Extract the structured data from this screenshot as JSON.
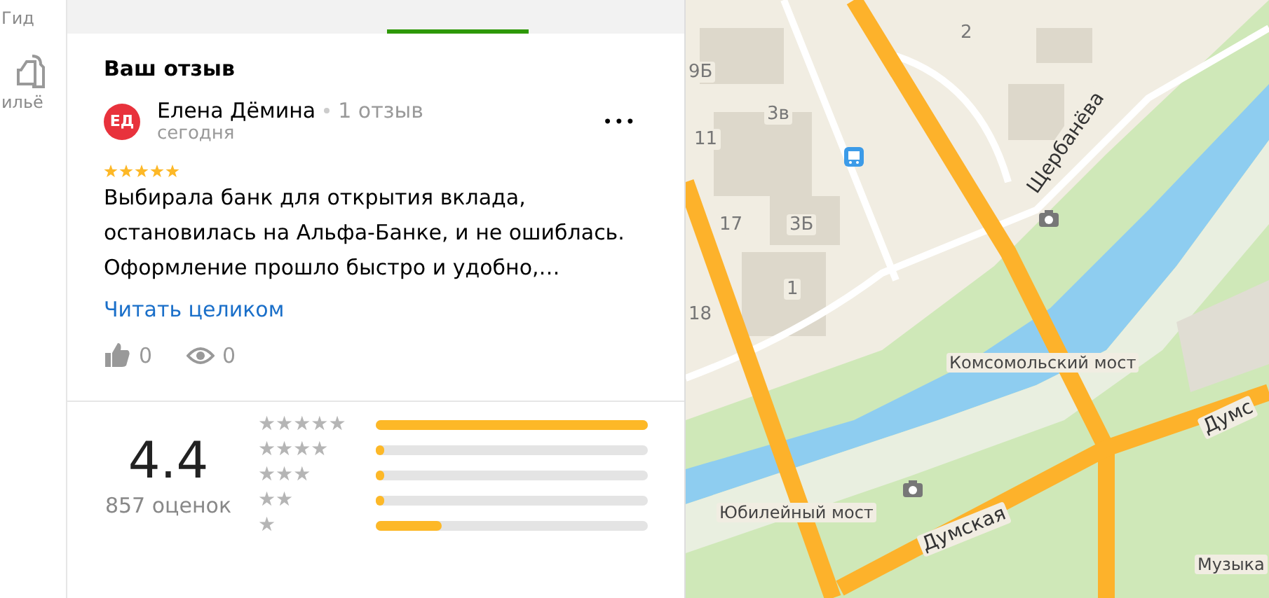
{
  "sidebar": {
    "items": [
      {
        "label": "Гид",
        "kind": "guide"
      },
      {
        "label": "ильё",
        "kind": "housing"
      }
    ]
  },
  "tabs": [
    {
      "selected": false
    },
    {
      "selected": false
    },
    {
      "selected": true
    },
    {
      "selected": false
    }
  ],
  "your_review": {
    "heading": "Ваш отзыв",
    "author": {
      "initials": "ЕД",
      "name": "Елена Дёмина",
      "review_count": "1 отзыв",
      "date": "сегодня"
    },
    "more": "•••",
    "stars": 5,
    "text": "Выбирала банк для открытия вклада, остановилась на Альфа-Банке, и не ошиблась. Оформление прошло быстро и удобно,…",
    "read_more": "Читать целиком",
    "likes": "0",
    "views": "0"
  },
  "rating": {
    "score": "4.4",
    "count": "857 оценок",
    "distribution": [
      {
        "label": "★★★★★",
        "level": 1.0
      },
      {
        "label": "★★★★",
        "level": 0.02
      },
      {
        "label": "★★★",
        "level": 0.02
      },
      {
        "label": "★★",
        "level": 0.02
      },
      {
        "label": "★",
        "level": 0.24
      }
    ]
  },
  "map": {
    "labels": [
      {
        "text": "Щербанёва",
        "kind": "street"
      },
      {
        "text": "Комсомольский мост",
        "kind": "place"
      },
      {
        "text": "Юбилейный мост",
        "kind": "place"
      },
      {
        "text": "Думская",
        "kind": "street"
      },
      {
        "text": "Думс",
        "kind": "street"
      },
      {
        "text": "Музыка",
        "kind": "place"
      },
      {
        "text": "9Б",
        "kind": "house"
      },
      {
        "text": "3в",
        "kind": "house"
      },
      {
        "text": "11",
        "kind": "house"
      },
      {
        "text": "17",
        "kind": "house"
      },
      {
        "text": "3Б",
        "kind": "house"
      },
      {
        "text": "1",
        "kind": "house"
      },
      {
        "text": "18",
        "kind": "house"
      },
      {
        "text": "2",
        "kind": "house"
      }
    ]
  }
}
